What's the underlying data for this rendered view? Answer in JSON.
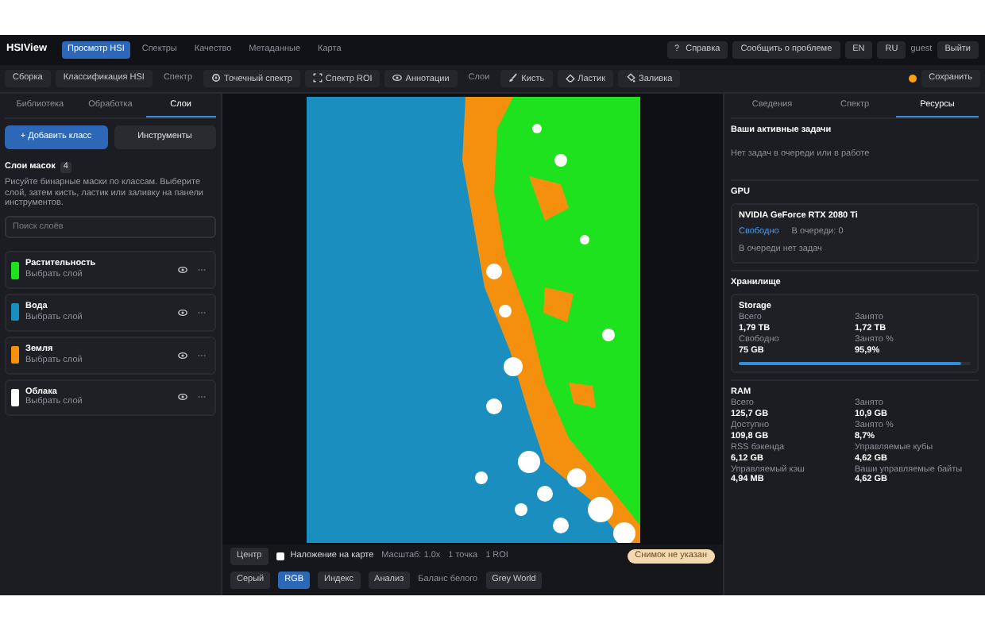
{
  "header": {
    "logo": "HSIView",
    "nav": [
      {
        "label": "Просмотр HSI",
        "selected": true
      },
      {
        "label": "Спектры",
        "selected": false
      },
      {
        "label": "Качество",
        "selected": false
      },
      {
        "label": "Метаданные",
        "selected": false
      },
      {
        "label": "Карта",
        "selected": false
      }
    ],
    "help": {
      "icon": "?",
      "label": "Справка"
    },
    "report": "Сообщить о проблеме",
    "languages": [
      {
        "label": "EN",
        "selected": false
      },
      {
        "label": "RU",
        "selected": false
      }
    ],
    "user": "guest",
    "logout": "Выйти"
  },
  "toolbar": {
    "left": [
      {
        "kind": "button",
        "label": "Сборка"
      },
      {
        "kind": "button",
        "label": "Классификация HSI"
      },
      {
        "kind": "label",
        "label": "Спектр"
      },
      {
        "kind": "tool",
        "label": "Точечный спектр"
      },
      {
        "kind": "tool",
        "label": "Спектр ROI"
      },
      {
        "kind": "tool",
        "label": "Аннотации"
      },
      {
        "kind": "label",
        "label": "Слои"
      },
      {
        "kind": "tool",
        "label": "Кисть"
      },
      {
        "kind": "tool",
        "label": "Ластик"
      },
      {
        "kind": "tool",
        "label": "Заливка"
      }
    ],
    "unsaved": true,
    "save": "Сохранить"
  },
  "left_panel": {
    "tabs": [
      {
        "label": "Библиотека",
        "selected": false
      },
      {
        "label": "Обработка",
        "selected": false
      },
      {
        "label": "Слои",
        "selected": true
      }
    ],
    "add_button": "+ Добавить класс",
    "tools_button": "Инструменты",
    "title": "Слои масок",
    "count": "4",
    "description": "Рисуйте бинарные маски по классам. Выберите слой, затем кисть, ластик или заливку на панели инструментов.",
    "search": {
      "placeholder": "Поиск слоёв"
    },
    "layers": [
      {
        "name": "Растительность",
        "hint": "Выбрать слой",
        "color": "#1fe21f",
        "visible": true
      },
      {
        "name": "Вода",
        "hint": "Выбрать слой",
        "color": "#1a8fbf",
        "visible": true
      },
      {
        "name": "Земля",
        "hint": "Выбрать слой",
        "color": "#f5900f",
        "visible": true
      },
      {
        "name": "Облака",
        "hint": "Выбрать слой",
        "color": "#ffffff",
        "visible": true
      }
    ]
  },
  "viewer": {
    "center_button": "Центр",
    "overlay": {
      "label": "Наложение на карте",
      "checked": false
    },
    "scale": "Масштаб: 1.0x",
    "points": "1 точка",
    "roi": "1 ROI",
    "image_badge": "Снимок не указан",
    "modes": [
      {
        "label": "Серый",
        "selected": false
      },
      {
        "label": "RGB",
        "selected": true
      },
      {
        "label": "Индекс",
        "selected": false
      },
      {
        "label": "Анализ",
        "selected": false
      }
    ],
    "white_balance_label": "Баланс белого",
    "white_balance": "Grey World"
  },
  "right_panel": {
    "tabs": [
      {
        "label": "Сведения",
        "selected": false
      },
      {
        "label": "Спектр",
        "selected": false
      },
      {
        "label": "Ресурсы",
        "selected": true
      }
    ],
    "tasks": {
      "title": "Ваши активные задачи",
      "empty": "Нет задач в очереди или в работе"
    },
    "gpu": {
      "title": "GPU",
      "name": "NVIDIA GeForce RTX 2080 Ti",
      "status": "Свободно",
      "queue": "В очереди: 0",
      "note": "В очереди нет задач"
    },
    "storage": {
      "title": "Хранилище",
      "name": "Storage",
      "level": 0.959,
      "stats": [
        {
          "label": "Всего",
          "value": "1,79 TB"
        },
        {
          "label": "Занято",
          "value": "1,72 TB"
        },
        {
          "label": "Свободно",
          "value": "75 GB"
        },
        {
          "label": "Занято %",
          "value": "95,9%"
        }
      ]
    },
    "ram": {
      "title": "RAM",
      "stats": [
        {
          "label": "Всего",
          "value": "125,7 GB"
        },
        {
          "label": "Занято",
          "value": "10,9 GB"
        },
        {
          "label": "Доступно",
          "value": "109,8 GB"
        },
        {
          "label": "Занято %",
          "value": "8,7%"
        },
        {
          "label": "RSS бэкенда",
          "value": "6,12 GB"
        },
        {
          "label": "Управляемые кубы",
          "value": "4,62 GB"
        },
        {
          "label": "Управляемый кэш",
          "value": "4,94 MB"
        },
        {
          "label": "Ваши управляемые байты",
          "value": "4,62 GB"
        }
      ]
    }
  }
}
